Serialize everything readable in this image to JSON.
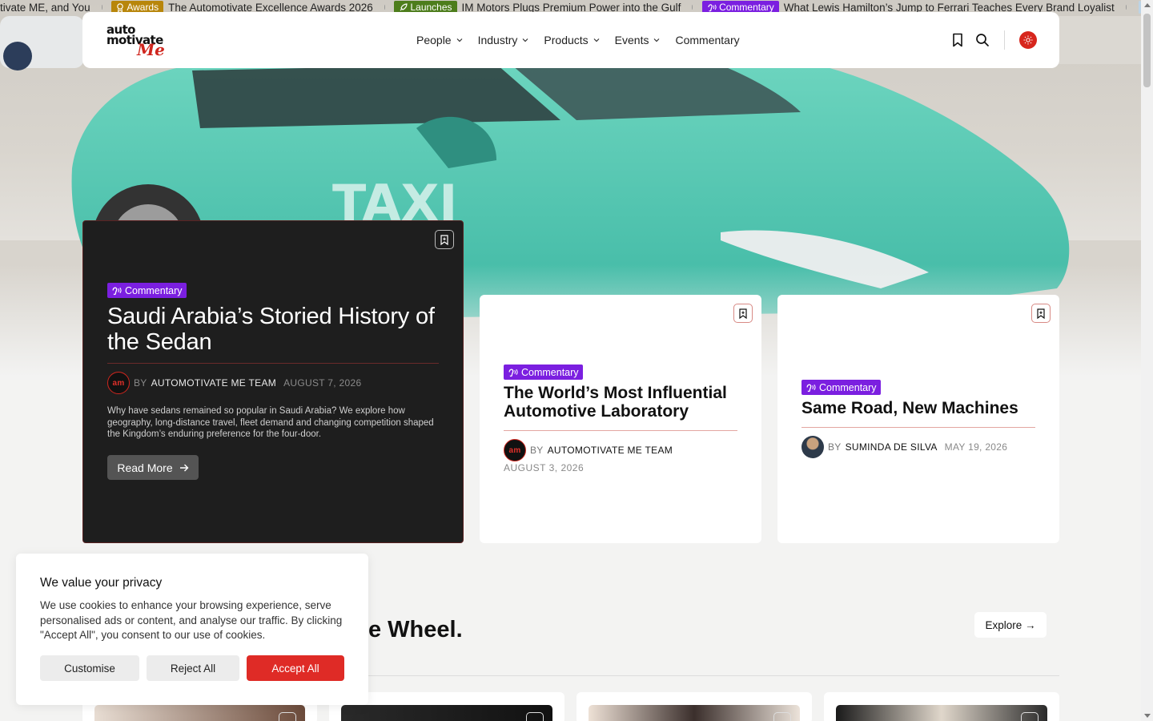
{
  "ticker": {
    "items": [
      {
        "badge": "",
        "text": "tivate ME, and You"
      },
      {
        "badge": "Awards",
        "badge_icon": "award-icon",
        "text": "The Automotivate Excellence Awards 2026"
      },
      {
        "badge": "Launches",
        "badge_icon": "rocket-icon",
        "text": "IM Motors Plugs Premium Power into the Gulf"
      },
      {
        "badge": "Commentary",
        "badge_icon": "megaphone-icon",
        "text": "What Lewis Hamilton’s Jump to Ferrari Teaches Every Brand Loyalist"
      }
    ]
  },
  "header": {
    "logo": {
      "line1": "auto",
      "line2": "motivate",
      "line3": "Me"
    },
    "nav": [
      {
        "label": "People",
        "has_dropdown": true
      },
      {
        "label": "Industry",
        "has_dropdown": true
      },
      {
        "label": "Products",
        "has_dropdown": true
      },
      {
        "label": "Events",
        "has_dropdown": true
      },
      {
        "label": "Commentary",
        "has_dropdown": false
      }
    ],
    "icons": [
      "bookmark-icon",
      "search-icon",
      "sun-icon"
    ]
  },
  "feature": {
    "category": "Commentary",
    "title": "Saudi Arabia’s Storied History of the Sedan",
    "avatar_text": "am",
    "by": "BY",
    "author": "Automotivate ME Team",
    "date": "August 7, 2026",
    "excerpt": "Why have sedans remained so popular in Saudi Arabia? We explore how geography, long-distance travel, fleet demand and changing competition shaped the Kingdom’s enduring preference for the four-door.",
    "read_more": "Read More"
  },
  "cards": [
    {
      "category": "Commentary",
      "title": "The World’s Most Influential Automotive Laboratory",
      "avatar_text": "am",
      "by": "BY",
      "author": "Automotivate ME Team",
      "date": "August 3, 2026"
    },
    {
      "category": "Commentary",
      "title": "Same Road, New Machines",
      "by": "BY",
      "author": "Suminda De Silva",
      "date": "May 19, 2026"
    }
  ],
  "section": {
    "title_visible": "e Wheel.",
    "explore": "Explore →"
  },
  "cookie": {
    "title": "We value your privacy",
    "body": "We use cookies to enhance your browsing experience, serve personalised ads or content, and analyse our traffic. By clicking \"Accept All\", you consent to our use of cookies.",
    "customise": "Customise",
    "reject": "Reject All",
    "accept": "Accept All"
  },
  "colors": {
    "accent_red": "#df2b26",
    "commentary_purple": "#7b1fe0",
    "awards_gold": "#b8860b",
    "launches_green": "#4d7d1c",
    "dark_card": "#1e1e1e"
  }
}
